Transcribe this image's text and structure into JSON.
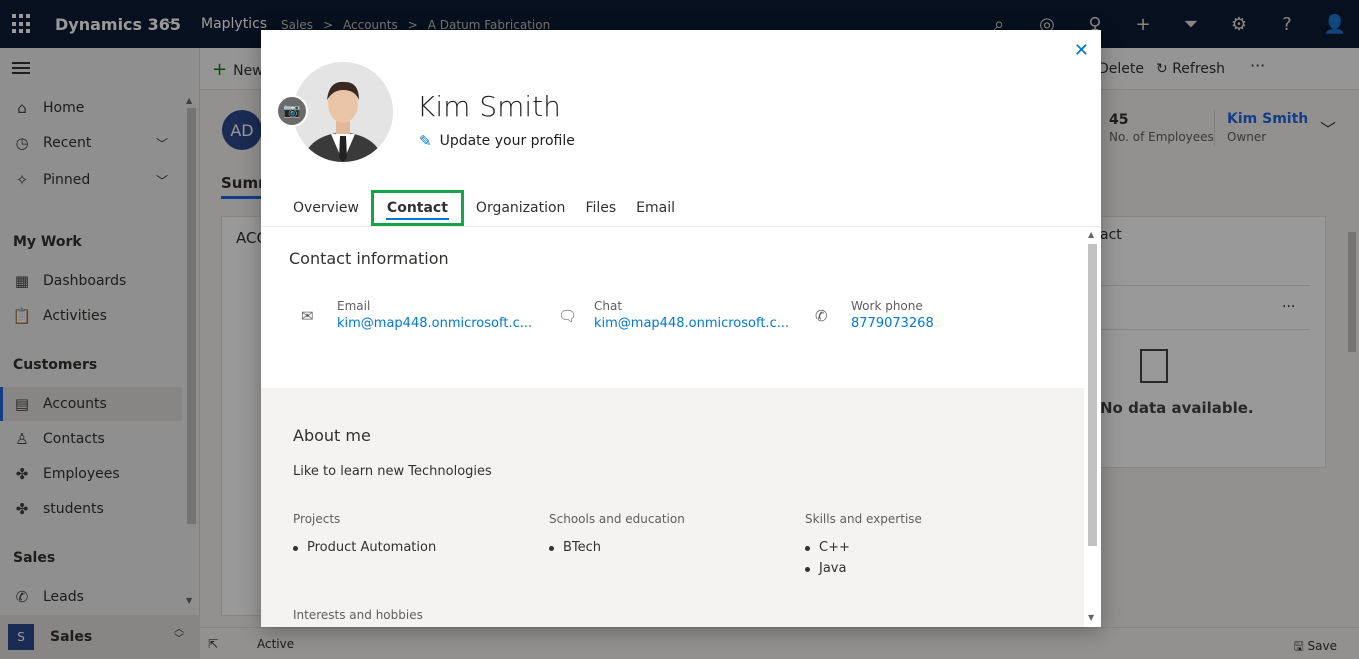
{
  "topbar": {
    "app_name": "Dynamics 365",
    "area": "Maplytics",
    "breadcrumbs": [
      "Sales",
      ">",
      "Accounts",
      ">",
      "A Datum Fabrication"
    ],
    "tools": [
      "search-icon",
      "assistant-icon",
      "lightbulb-icon",
      "plus-icon",
      "filter-icon",
      "settings-icon",
      "help-icon",
      "user-icon"
    ]
  },
  "sitemap": {
    "home": "Home",
    "recent": "Recent",
    "pinned": "Pinned",
    "my_work": "My Work",
    "dashboards": "Dashboards",
    "activities": "Activities",
    "customers": "Customers",
    "accounts": "Accounts",
    "contacts": "Contacts",
    "employees": "Employees",
    "students": "students",
    "sales": "Sales",
    "leads": "Leads",
    "area_badge": "S",
    "area_label": "Sales"
  },
  "background": {
    "new_label": "New",
    "delete_label": "Delete",
    "refresh_label": "Refresh",
    "more": "···",
    "avatar_initials": "AD",
    "tab_summary": "Summ",
    "card_title": "ACC",
    "employees_count": "45",
    "employees_label": "No. of Employees",
    "owner_name": "Kim Smith",
    "owner_label": "Owner",
    "right_card_title": "act",
    "right_card_dots": "···",
    "no_data": "No data available.",
    "status": "Active",
    "save_label": "Save"
  },
  "dialog": {
    "name": "Kim Smith",
    "update_profile": "Update your profile",
    "tabs": [
      "Overview",
      "Contact",
      "Organization",
      "Files",
      "Email"
    ],
    "active_tab": "Contact",
    "contact_heading": "Contact information",
    "contact": {
      "email_label": "Email",
      "email_value": "kim@map448.onmicrosoft.c...",
      "chat_label": "Chat",
      "chat_value": "kim@map448.onmicrosoft.c...",
      "phone_label": "Work phone",
      "phone_value": "8779073268"
    },
    "about_heading": "About me",
    "about_text": "Like to learn new Technologies",
    "projects_label": "Projects",
    "projects": [
      "Product Automation"
    ],
    "schools_label": "Schools and education",
    "schools": [
      "BTech"
    ],
    "skills_label": "Skills and expertise",
    "skills": [
      "C++",
      "Java"
    ],
    "interests_label": "Interests and hobbies"
  },
  "colors": {
    "topbar": "#0c1b33",
    "accent": "#0078d4",
    "highlight_box": "#16a34a"
  }
}
